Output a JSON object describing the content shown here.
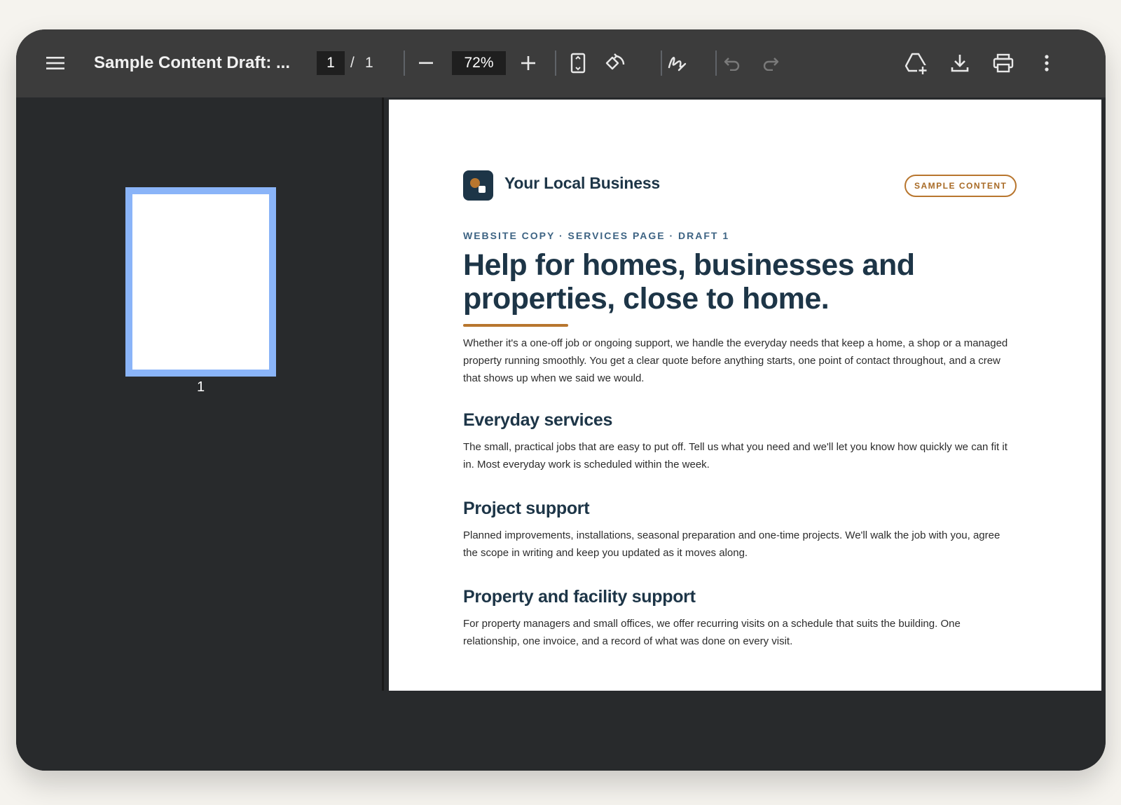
{
  "toolbar": {
    "title": "Sample Content Draft: ...",
    "current_page": "1",
    "page_separator": "/",
    "total_pages": "1",
    "zoom": "72%",
    "icons": {
      "menu": "menu-icon",
      "zoom_out": "minus-icon",
      "zoom_in": "plus-icon",
      "fit": "fit-page-icon",
      "rotate": "rotate-icon",
      "annotate": "annotate-pen-icon",
      "undo": "undo-icon",
      "redo": "redo-icon",
      "add_to_drive": "add-to-drive-icon",
      "download": "download-icon",
      "print": "print-icon",
      "more": "more-vert-icon"
    }
  },
  "sidebar": {
    "thumbnails": [
      {
        "label": "1"
      }
    ]
  },
  "document": {
    "business_name": "Your Local Business",
    "badge": "SAMPLE CONTENT",
    "eyebrow": "WEBSITE COPY · SERVICES PAGE · DRAFT 1",
    "headline": "Help for homes, businesses and properties, close to home.",
    "intro": "Whether it's a one-off job or ongoing support, we handle the everyday needs that keep a home, a shop or a managed property running smoothly. You get a clear quote before anything starts, one point of contact throughout, and a crew that shows up when we said we would.",
    "sections": [
      {
        "title": "Everyday services",
        "body": "The small, practical jobs that are easy to put off. Tell us what you need and we'll let you know how quickly we can fit it in. Most everyday work is scheduled within the week."
      },
      {
        "title": "Project support",
        "body": "Planned improvements, installations, seasonal preparation and one-time projects. We'll walk the job with you, agree the scope in writing and keep you updated as it moves along."
      },
      {
        "title": "Property and facility support",
        "body": "For property managers and small offices, we offer recurring visits on a schedule that suits the building. One relationship, one invoice, and a record of what was done on every visit."
      }
    ]
  },
  "colors": {
    "toolbar_bg": "#3c3c3c",
    "viewer_bg": "#282a2c",
    "thumb_selected": "#8ab4f8",
    "brand_navy": "#1d3547",
    "brand_accent": "#b8762e"
  }
}
